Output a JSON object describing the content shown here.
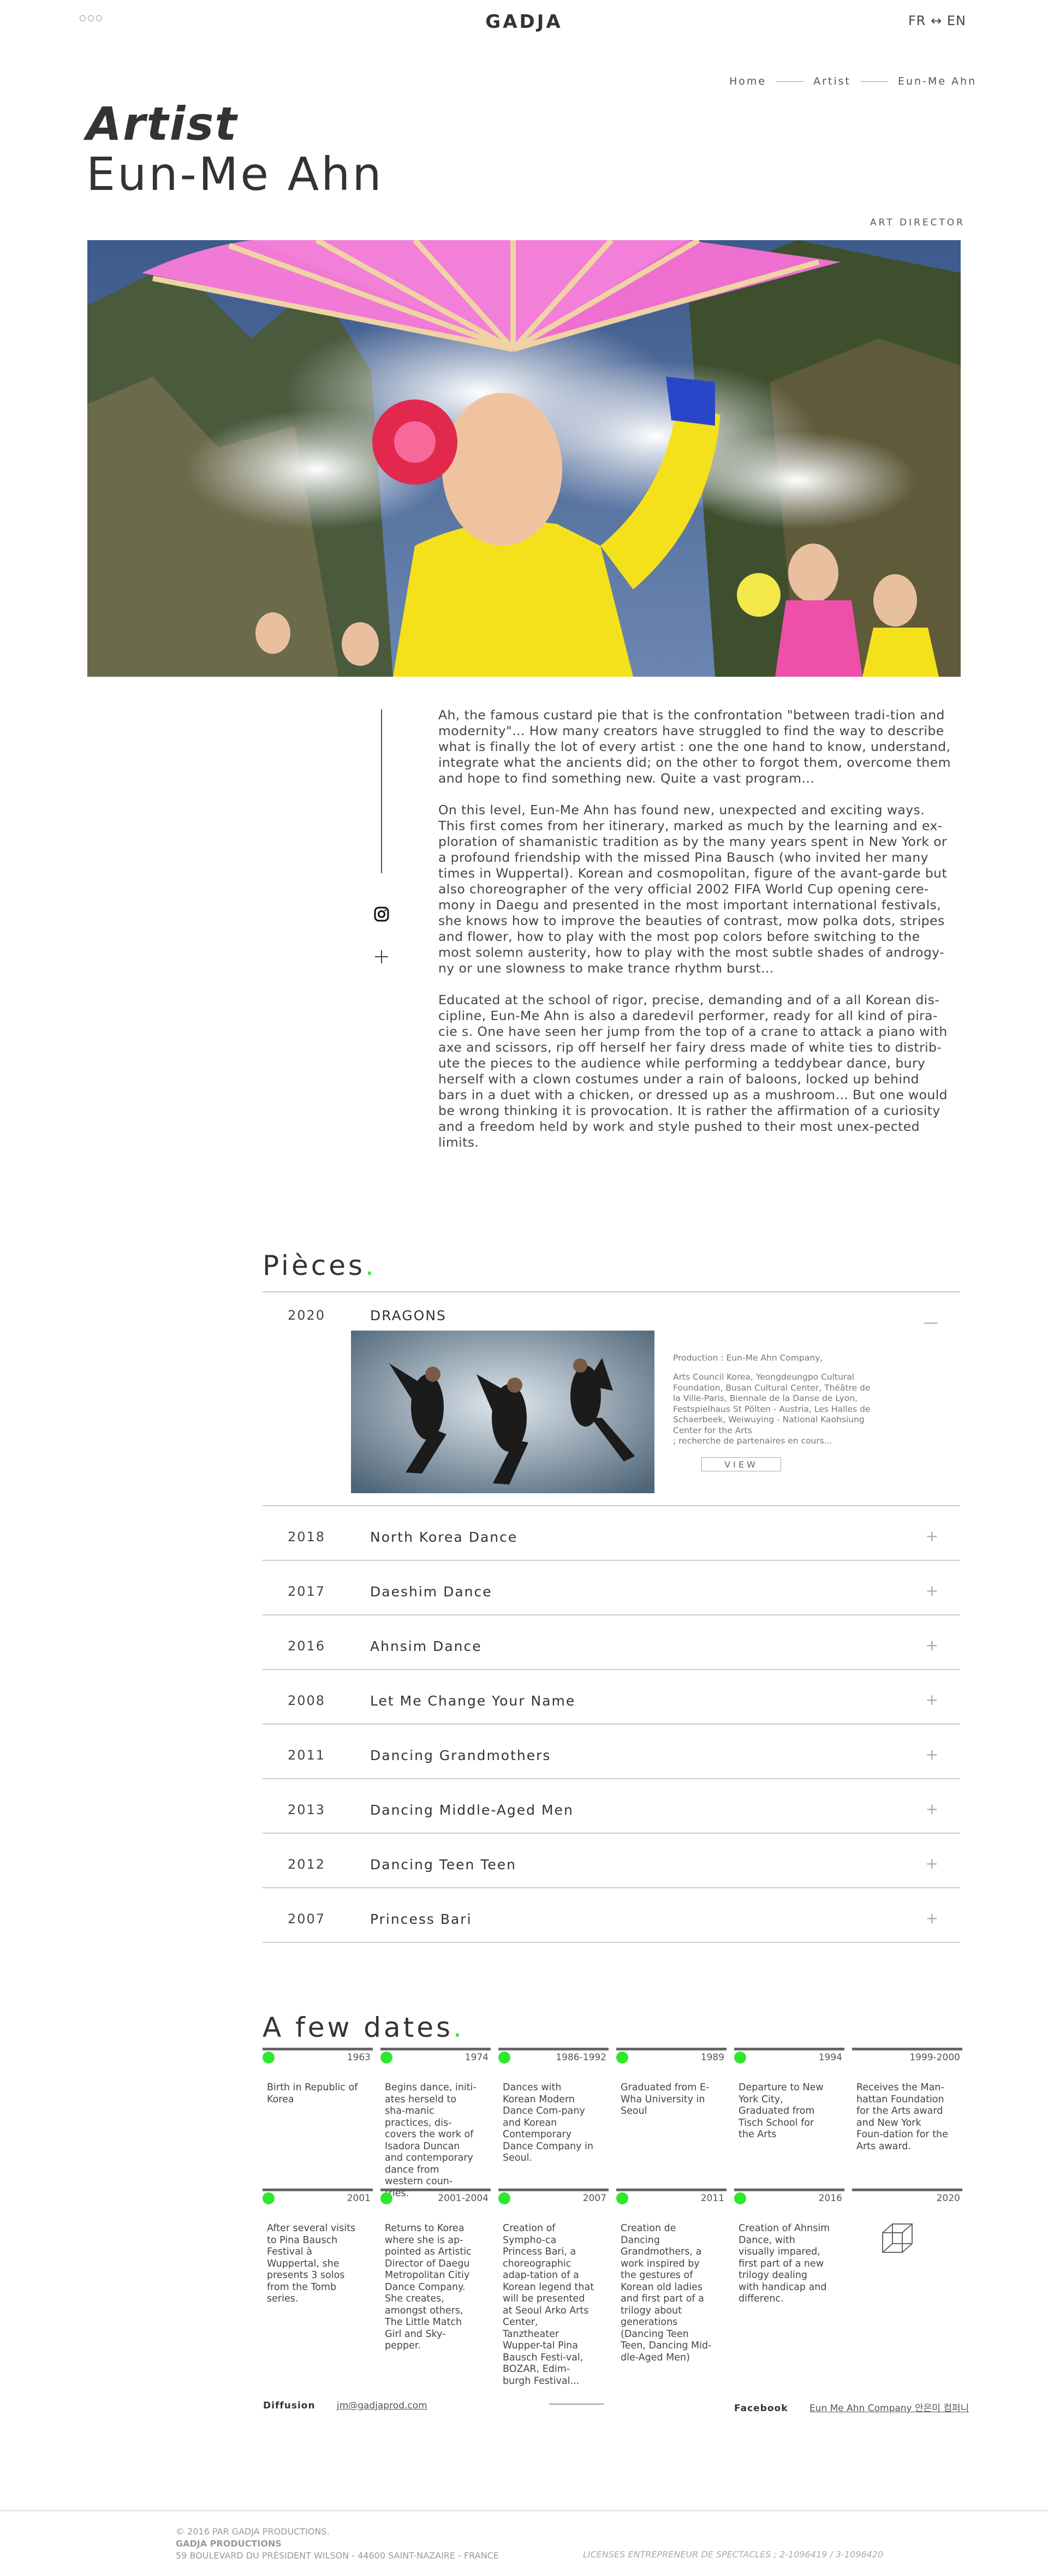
{
  "header": {
    "logo": "GADJA",
    "lang": "FR ↔ EN"
  },
  "breadcrumb": [
    "Home",
    "Artist",
    "Eun-Me Ahn"
  ],
  "title": {
    "kicker": "Artist",
    "name": "Eun-Me Ahn",
    "role": "ART DIRECTOR"
  },
  "bio": [
    "Ah, the famous custard pie that is the confrontation \"between tradi-tion and modernity\"... How many creators have struggled to find the way to describe what is finally the lot of every artist : one the one hand to know, understand, integrate what the ancients did; on the other to forgot them, overcome them and hope to find something new. Quite a vast program...",
    "On this level, Eun-Me Ahn has found new, unexpected and exciting ways. This first comes from her itinerary, marked as much by the learning and ex-ploration of shamanistic tradition as by the many years spent in New York or a profound friendship with the missed Pina Bausch (who invited her many times in Wuppertal). Korean and cosmopolitan, figure of the avant-garde but also choreographer of the very official 2002 FIFA World Cup opening cere-mony in Daegu and presented in the most important international festivals, she knows how to improve the beauties of contrast, mow polka dots, stripes and flower, how to play with the most pop colors before switching to the most solemn austerity, how to play with the most subtle shades of androgy-ny or une slowness to make trance rhythm burst...",
    "Educated at the school of rigor, precise, demanding and of a all Korean dis-cipline, Eun-Me Ahn is also a daredevil performer, ready for all kind of pira-cie s. One have seen her jump from the top of a crane to attack a piano with axe and scissors, rip off herself her fairy dress made of white ties to distrib-ute the pieces to the audience while performing a teddybear dance, bury herself with a clown costumes under a rain of baloons, locked up behind bars in a duet with a chicken, or dressed up as a mushroom...  But one would be wrong thinking it is provocation. It is rather the affirmation of a curiosity and a freedom held by work and style pushed to their most unex-pected limits."
  ],
  "pieces": {
    "heading": "Pièces",
    "heading_dot": ".",
    "open": {
      "year": "2020",
      "title": "DRAGONS",
      "toggle": "—",
      "production": "Production : Eun-Me Ahn Company,",
      "partners": "Arts Council Korea, Yeongdeungpo Cultural Foundation, Busan Cultural Center, Théâtre de la Ville-Paris, Biennale de la Danse de Lyon, Festspielhaus St Pölten - Austria, Les Halles de Schaerbeek, Weiwuying - National Kaohsiung Center for the Arts\n; recherche de partenaires en cours...",
      "view": "VIEW"
    },
    "items": [
      {
        "year": "2018",
        "title": "North Korea Dance",
        "toggle": "+"
      },
      {
        "year": "2017",
        "title": "Daeshim Dance",
        "toggle": "+"
      },
      {
        "year": "2016",
        "title": "Ahnsim Dance",
        "toggle": "+"
      },
      {
        "year": "2008",
        "title": "Let Me Change Your Name",
        "toggle": "+"
      },
      {
        "year": "2011",
        "title": "Dancing Grandmothers",
        "toggle": "+"
      },
      {
        "year": "2013",
        "title": "Dancing Middle-Aged Men",
        "toggle": "+"
      },
      {
        "year": "2012",
        "title": "Dancing Teen Teen",
        "toggle": "+"
      },
      {
        "year": "2007",
        "title": "Princess Bari",
        "toggle": "+"
      }
    ]
  },
  "dates": {
    "heading": "A few dates",
    "heading_dot": ".",
    "items": [
      {
        "year": "1963",
        "text": "Birth in Republic of Korea"
      },
      {
        "year": "1974",
        "text": "Begins dance, initi-ates herseld to sha-manic practices, dis-covers the work of Isadora Duncan and contemporary dance from western coun-tries."
      },
      {
        "year": "1986-1992",
        "text": "Dances with Korean Modern Dance Com-pany and Korean Contemporary Dance Company in Seoul."
      },
      {
        "year": "1989",
        "text": "Graduated from E-Wha University in Seoul"
      },
      {
        "year": "1994",
        "text": "Departure to New York City, Graduated from Tisch School for the Arts"
      },
      {
        "year": "1999-2000",
        "text": "Receives the Man-hattan Foundation for the Arts award and New York Foun-dation for the Arts award."
      },
      {
        "year": "2001",
        "text": "After several visits to Pina Bausch Festival à Wuppertal, she presents 3 solos from the Tomb series."
      },
      {
        "year": "2001-2004",
        "text": "Returns to Korea where she is ap-pointed as Artistic Director of Daegu Metropolitan Citiy Dance Company. She creates, amongst others, The Little Match Girl  and  Sky-pepper."
      },
      {
        "year": "2007",
        "text": "Creation of Sympho-ca Princess Bari, a choreographic adap-tation of a Korean legend that will be presented at Seoul Arko Arts Center, Tanztheater Wupper-tal Pina Bausch Festi-val, BOZAR, Edim-burgh Festival..."
      },
      {
        "year": "2011",
        "text": "Creation de Dancing Grandmothers,  a work inspired by the gestures of Korean old ladies and first part of a trilogy about generations (Dancing Teen Teen, Dancing Mid-dle-Aged Men)"
      },
      {
        "year": "2016",
        "text": "Creation of Ahnsim Dance, with visually impared, first part of a new trilogy dealing with handicap and differenc."
      },
      {
        "year": "2020",
        "text": ""
      }
    ]
  },
  "contact": {
    "diffusion_label": "Diffusion",
    "email": "jm@gadjaprod.com",
    "facebook_label": "Facebook",
    "facebook_link": "Eun Me Ahn Company 안은미 컴퍼니"
  },
  "footer": {
    "copyright": "© 2016 PAR GADJA PRODUCTIONS.",
    "company": "GADJA PRODUCTIONS",
    "address": "59 BOULEVARD DU PRÉSIDENT WILSON - 44600 SAINT-NAZAIRE - FRANCE",
    "licenses": "LICENSES ENTREPRENEUR DE SPECTACLES ; 2-1096419 / 3-1096420"
  },
  "colors": {
    "accent_green": "#2ee82e"
  }
}
